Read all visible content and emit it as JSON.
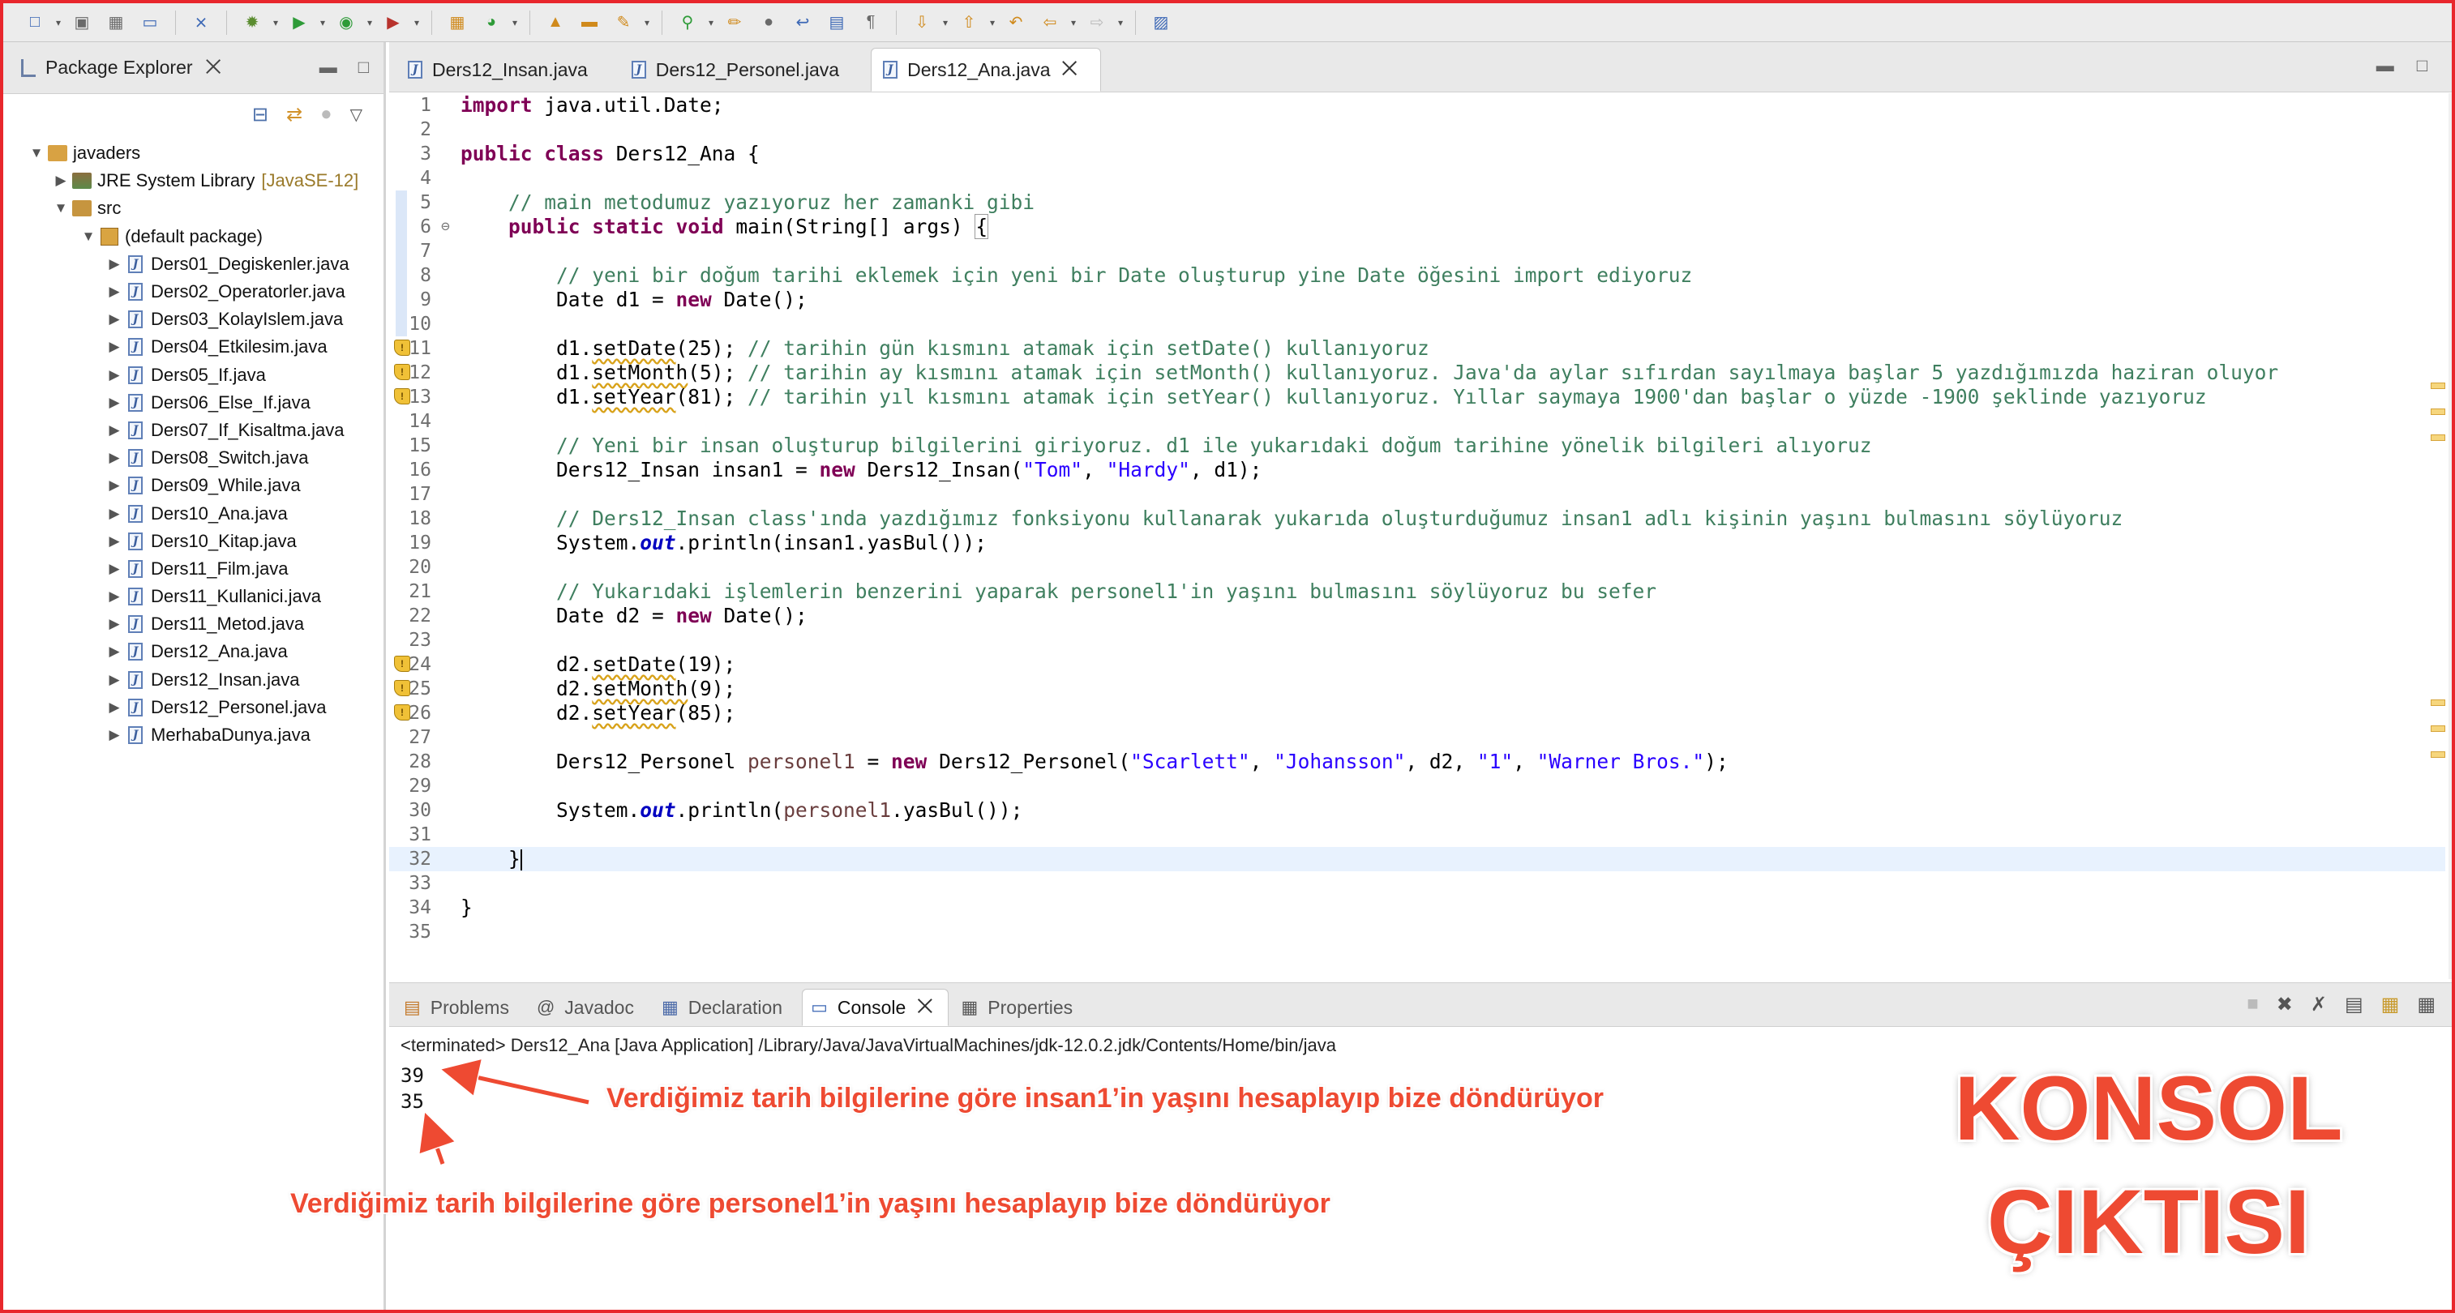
{
  "toolbar": {
    "buttons": [
      "new-file-icon",
      "save-icon",
      "save-all-icon",
      "terminal-icon",
      "skip-breakpoints-icon",
      "debug-icon",
      "run-icon",
      "coverage-icon",
      "external-tools-icon",
      "new-java-project-icon",
      "new-package-icon",
      "new-class-icon",
      "open-type-icon",
      "open-task-icon",
      "search-icon",
      "mark-occurrences-icon",
      "block-select-icon",
      "word-wrap-icon",
      "show-whitespace-icon",
      "next-annotation-icon",
      "prev-annotation-icon",
      "last-edit-icon",
      "back-icon",
      "forward-icon",
      "perspective-icon"
    ]
  },
  "explorer": {
    "title": "Package Explorer",
    "project": "javaders",
    "library": "JRE System Library",
    "library_version": "[JavaSE-12]",
    "src": "src",
    "package": "(default package)",
    "files": [
      "Ders01_Degiskenler.java",
      "Ders02_Operatorler.java",
      "Ders03_KolayIslem.java",
      "Ders04_Etkilesim.java",
      "Ders05_If.java",
      "Ders06_Else_If.java",
      "Ders07_If_Kisaltma.java",
      "Ders08_Switch.java",
      "Ders09_While.java",
      "Ders10_Ana.java",
      "Ders10_Kitap.java",
      "Ders11_Film.java",
      "Ders11_Kullanici.java",
      "Ders11_Metod.java",
      "Ders12_Ana.java",
      "Ders12_Insan.java",
      "Ders12_Personel.java",
      "MerhabaDunya.java"
    ]
  },
  "editor": {
    "tabs": [
      {
        "label": "Ders12_Insan.java",
        "active": false
      },
      {
        "label": "Ders12_Personel.java",
        "active": false
      },
      {
        "label": "Ders12_Ana.java",
        "active": true
      }
    ],
    "lines": [
      "1",
      "2",
      "3",
      "4",
      "5",
      "6",
      "7",
      "8",
      "9",
      "10",
      "11",
      "12",
      "13",
      "14",
      "15",
      "16",
      "17",
      "18",
      "19",
      "20",
      "21",
      "22",
      "23",
      "24",
      "25",
      "26",
      "27",
      "28",
      "29",
      "30",
      "31",
      "32",
      "33",
      "34",
      "35"
    ],
    "code": {
      "l1_kw": "import",
      "l1": " java.util.Date;",
      "l3_kw1": "public",
      "l3_kw2": "class",
      "l3": " Ders12_Ana {",
      "l5": "    // main metodumuz yazıyoruz her zamanki gibi",
      "l6_kw1": "public",
      "l6_kw2": "static",
      "l6_kw3": "void",
      "l6a": " main(String[] args) ",
      "l6b": "{",
      "l8": "        // yeni bir doğum tarihi eklemek için yeni bir Date oluşturup yine Date öğesini import ediyoruz",
      "l9a": "        Date d1 = ",
      "l9_kw": "new",
      "l9b": " Date();",
      "l11a": "        d1.",
      "l11_m": "setDate",
      "l11b": "(25); ",
      "l11c": "// tarihin gün kısmını atamak için setDate() kullanıyoruz",
      "l12a": "        d1.",
      "l12_m": "setMonth",
      "l12b": "(5); ",
      "l12c": "// tarihin ay kısmını atamak için setMonth() kullanıyoruz. Java'da aylar sıfırdan sayılmaya başlar 5 yazdığımızda haziran oluyor",
      "l13a": "        d1.",
      "l13_m": "setYear",
      "l13b": "(81); ",
      "l13c": "// tarihin yıl kısmını atamak için setYear() kullanıyoruz. Yıllar saymaya 1900'dan başlar o yüzde -1900 şeklinde yazıyoruz",
      "l15": "        // Yeni bir insan oluşturup bilgilerini giriyoruz. d1 ile yukarıdaki doğum tarihine yönelik bilgileri alıyoruz",
      "l16a": "        Ders12_Insan insan1 = ",
      "l16_kw": "new",
      "l16b": " Ders12_Insan(",
      "l16_s1": "\"Tom\"",
      "l16c": ", ",
      "l16_s2": "\"Hardy\"",
      "l16d": ", d1);",
      "l18": "        // Ders12_Insan class'ında yazdığımız fonksiyonu kullanarak yukarıda oluşturduğumuz insan1 adlı kişinin yaşını bulmasını söylüyoruz",
      "l19a": "        System.",
      "l19_f": "out",
      "l19b": ".println(insan1.yasBul());",
      "l21": "        // Yukarıdaki işlemlerin benzerini yaparak personel1'in yaşını bulmasını söylüyoruz bu sefer",
      "l22a": "        Date d2 = ",
      "l22_kw": "new",
      "l22b": " Date();",
      "l24a": "        d2.",
      "l24_m": "setDate",
      "l24b": "(19);",
      "l25a": "        d2.",
      "l25_m": "setMonth",
      "l25b": "(9);",
      "l26a": "        d2.",
      "l26_m": "setYear",
      "l26b": "(85);",
      "l28a": "        Ders12_Personel ",
      "l28_v": "personel1",
      "l28b": " = ",
      "l28_kw": "new",
      "l28c": " Ders12_Personel(",
      "l28_s1": "\"Scarlett\"",
      "l28d": ", ",
      "l28_s2": "\"Johansson\"",
      "l28e": ", d2, ",
      "l28_s3": "\"1\"",
      "l28f": ", ",
      "l28_s4": "\"Warner Bros.\"",
      "l28g": ");",
      "l30a": "        System.",
      "l30_f": "out",
      "l30b": ".println(",
      "l30_v": "personel1",
      "l30c": ".yasBul());",
      "l32": "    }",
      "l34": "}"
    }
  },
  "console": {
    "tabs": [
      {
        "label": "Problems",
        "icon": "problems-icon"
      },
      {
        "label": "Javadoc",
        "icon": "javadoc-icon"
      },
      {
        "label": "Declaration",
        "icon": "declaration-icon"
      },
      {
        "label": "Console",
        "icon": "console-icon",
        "active": true
      },
      {
        "label": "Properties",
        "icon": "properties-icon"
      }
    ],
    "header": "<terminated> Ders12_Ana [Java Application] /Library/Java/JavaVirtualMachines/jdk-12.0.2.jdk/Contents/Home/bin/java",
    "output": [
      "39",
      "35"
    ]
  },
  "annotations": {
    "insan": "Verdiğimiz tarih bilgilerine göre insan1’in yaşını hesaplayıp bize döndürüyor",
    "personel": "Verdiğimiz tarih bilgilerine göre personel1’in yaşını hesaplayıp bize döndürüyor",
    "title_line1": "KONSOL",
    "title_line2": "ÇIKTISI"
  },
  "colors": {
    "keyword": "#7f0055",
    "comment": "#3f7f5f",
    "string": "#2a00ff",
    "static_field": "#0000c0",
    "annotation": "#ee4a32",
    "frame": "#e8272c"
  }
}
